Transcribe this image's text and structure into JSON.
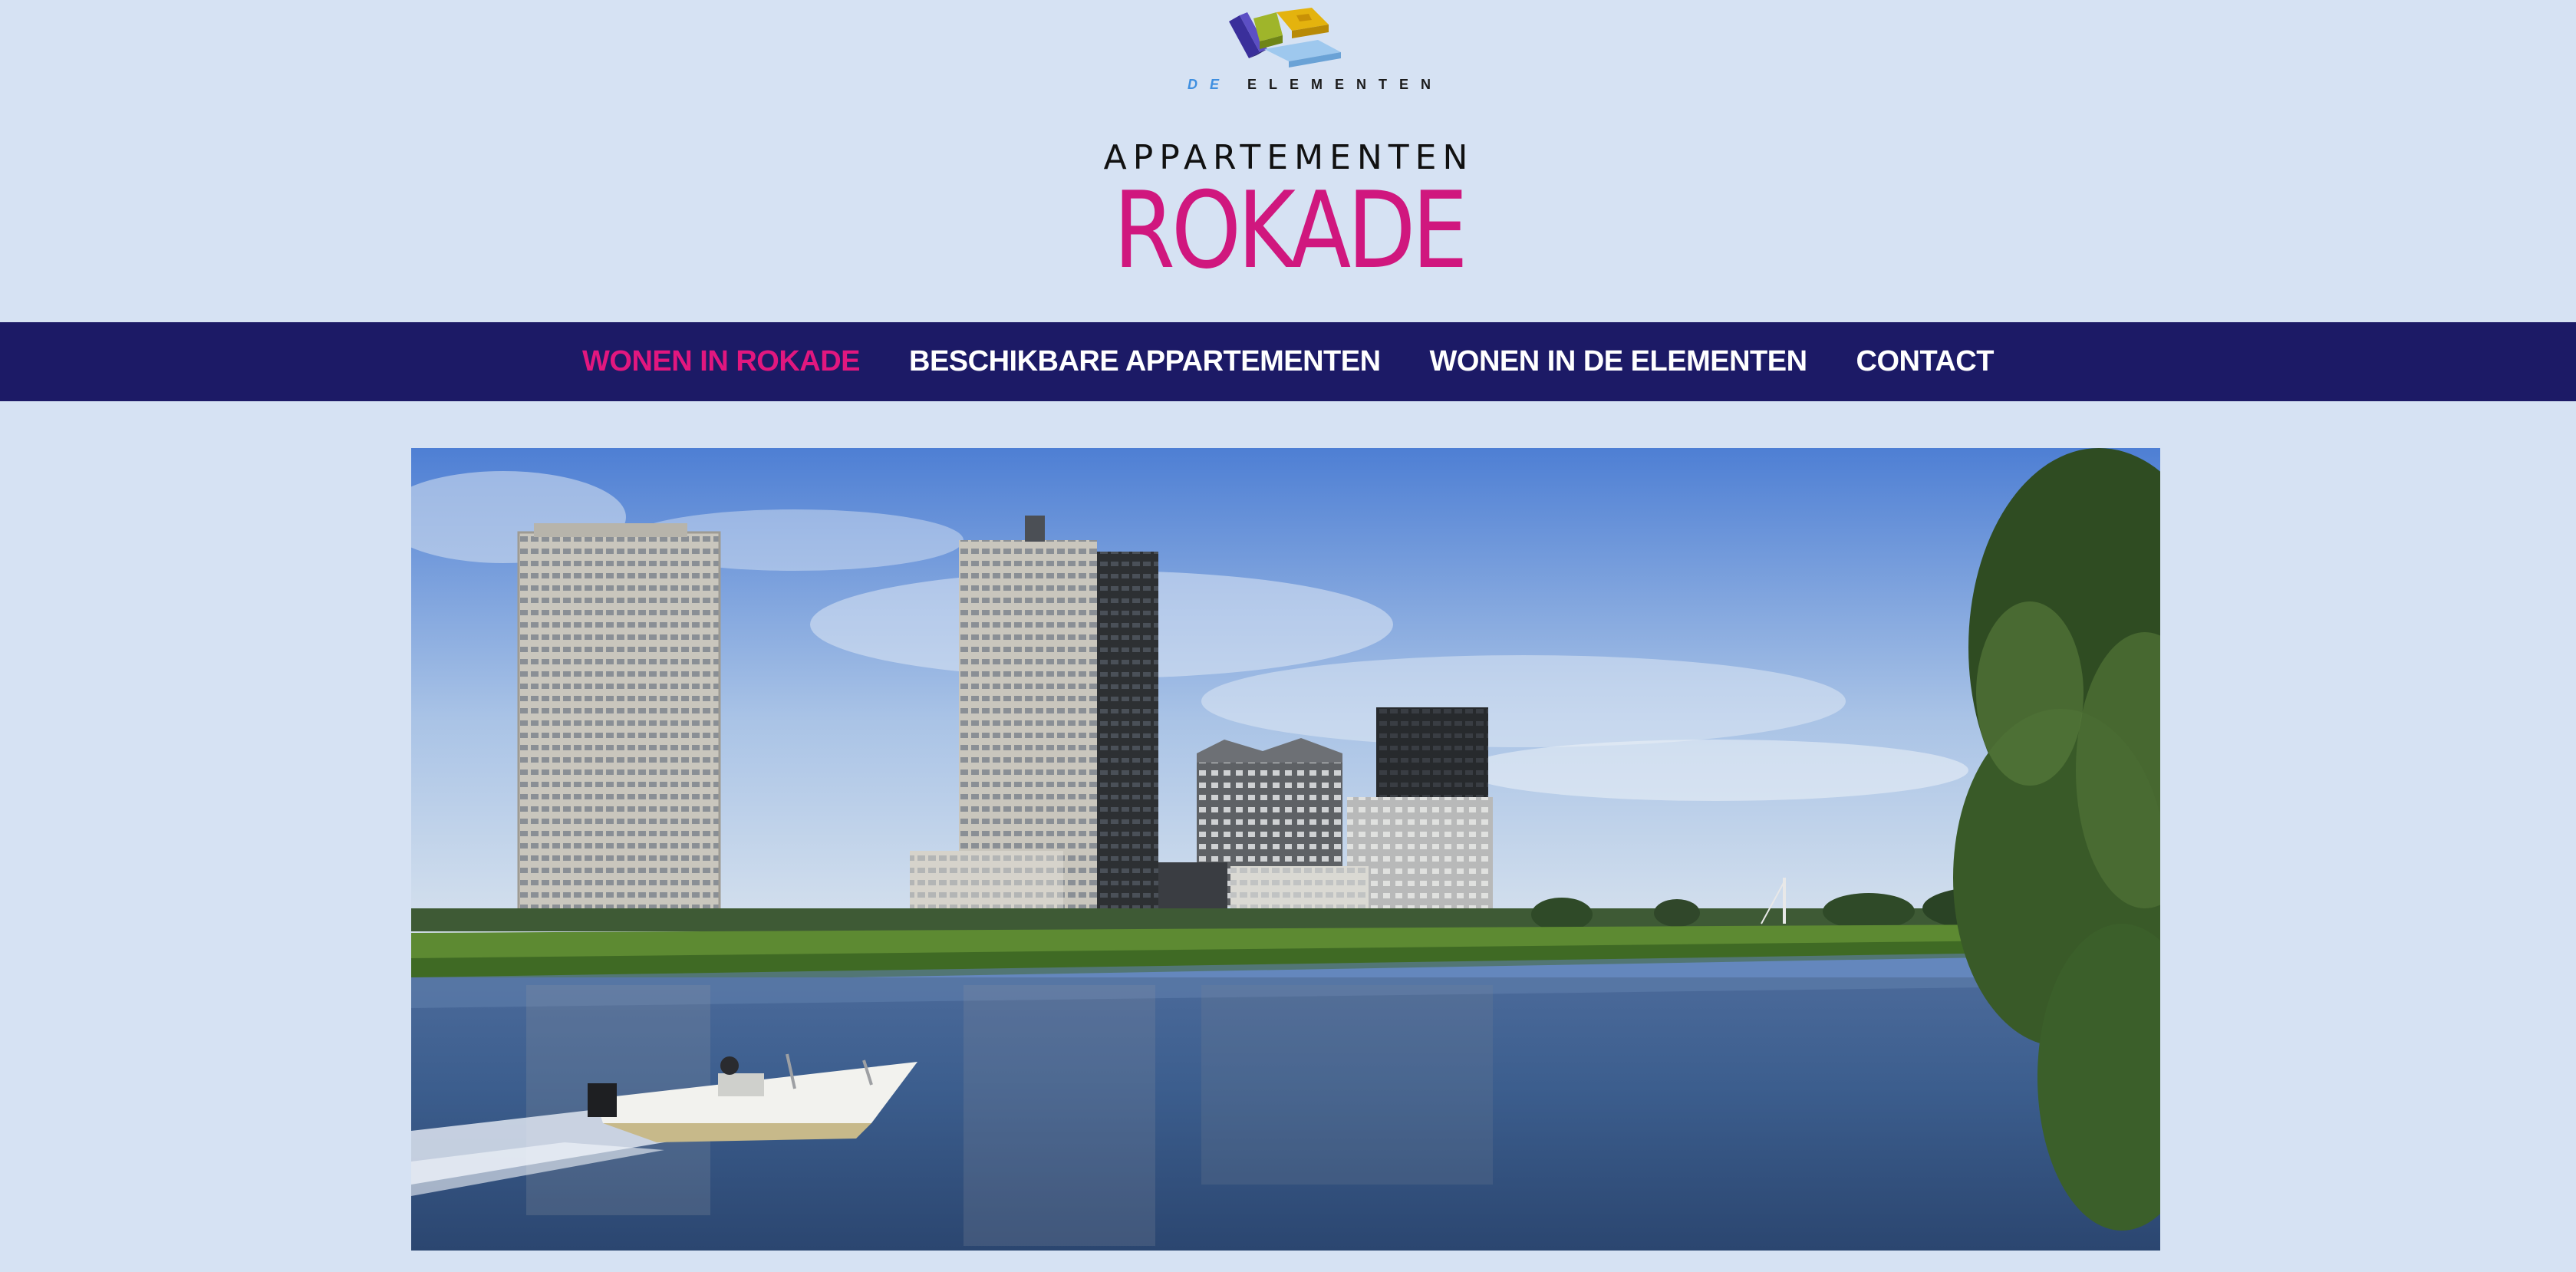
{
  "brand": {
    "logo_icon": "de-elementen-blocks-logo",
    "wordmark_prefix": "DE",
    "wordmark_main": "ELEMENTEN"
  },
  "header": {
    "subtitle": "APPARTEMENTEN",
    "title": "ROKADE"
  },
  "nav": {
    "items": [
      {
        "label": "WONEN IN ROKADE",
        "active": true
      },
      {
        "label": "BESCHIKBARE APPARTEMENTEN",
        "active": false
      },
      {
        "label": "WONEN IN DE ELEMENTEN",
        "active": false
      },
      {
        "label": "CONTACT",
        "active": false
      }
    ]
  },
  "hero": {
    "image": "river-skyline-with-speedboat-photo"
  },
  "colors": {
    "page_background": "#d6e2f3",
    "nav_background": "#1c1a66",
    "nav_text": "#ffffff",
    "accent_pink": "#d0177e"
  }
}
